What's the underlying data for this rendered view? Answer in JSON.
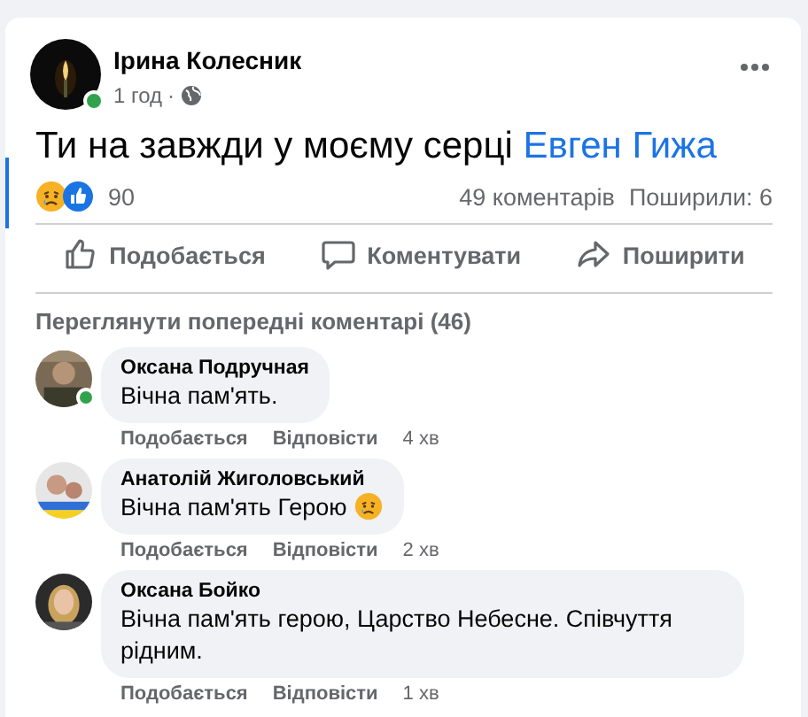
{
  "post": {
    "author": "Ірина Колесник",
    "online": true,
    "time": "1 год",
    "separator": "·",
    "text": "Ти на завжди у моєму серці",
    "tag": "Евген Гижа"
  },
  "reactions": {
    "count": "90",
    "comments": "49 коментарів",
    "shares": "Поширили: 6"
  },
  "actions": [
    {
      "kind": "like",
      "label": "Подобається"
    },
    {
      "kind": "comment",
      "label": "Коментувати"
    },
    {
      "kind": "share",
      "label": "Поширити"
    }
  ],
  "view_previous": "Переглянути попередні коментарі (46)",
  "comments": [
    {
      "name": "Оксана Подручная",
      "text": "Вічна пам'ять.",
      "emoji": false,
      "online": true,
      "like": "Подобається",
      "reply": "Відповісти",
      "time": "4 хв"
    },
    {
      "name": "Анатолій Жиголовський",
      "text": "Вічна пам'ять Герою",
      "emoji": true,
      "online": false,
      "like": "Подобається",
      "reply": "Відповісти",
      "time": "2 хв"
    },
    {
      "name": "Оксана Бойко",
      "text": "Вічна пам'ять герою, Царство Небесне. Співчуття рідним.",
      "emoji": false,
      "online": false,
      "like": "Подобається",
      "reply": "Відповісти",
      "time": "1 хв"
    }
  ]
}
